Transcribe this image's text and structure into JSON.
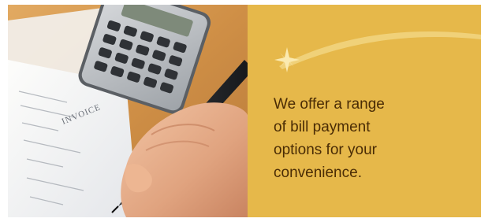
{
  "banner": {
    "message": "We offer a range\nof bill payment\noptions for your\nconvenience.",
    "photo": {
      "document_heading": "INVOICE"
    },
    "colors": {
      "panel_background": "#e6b84a",
      "message_text": "#4a2c05",
      "swoosh": "#f3d98a",
      "sparkle": "#fbeab0"
    }
  }
}
